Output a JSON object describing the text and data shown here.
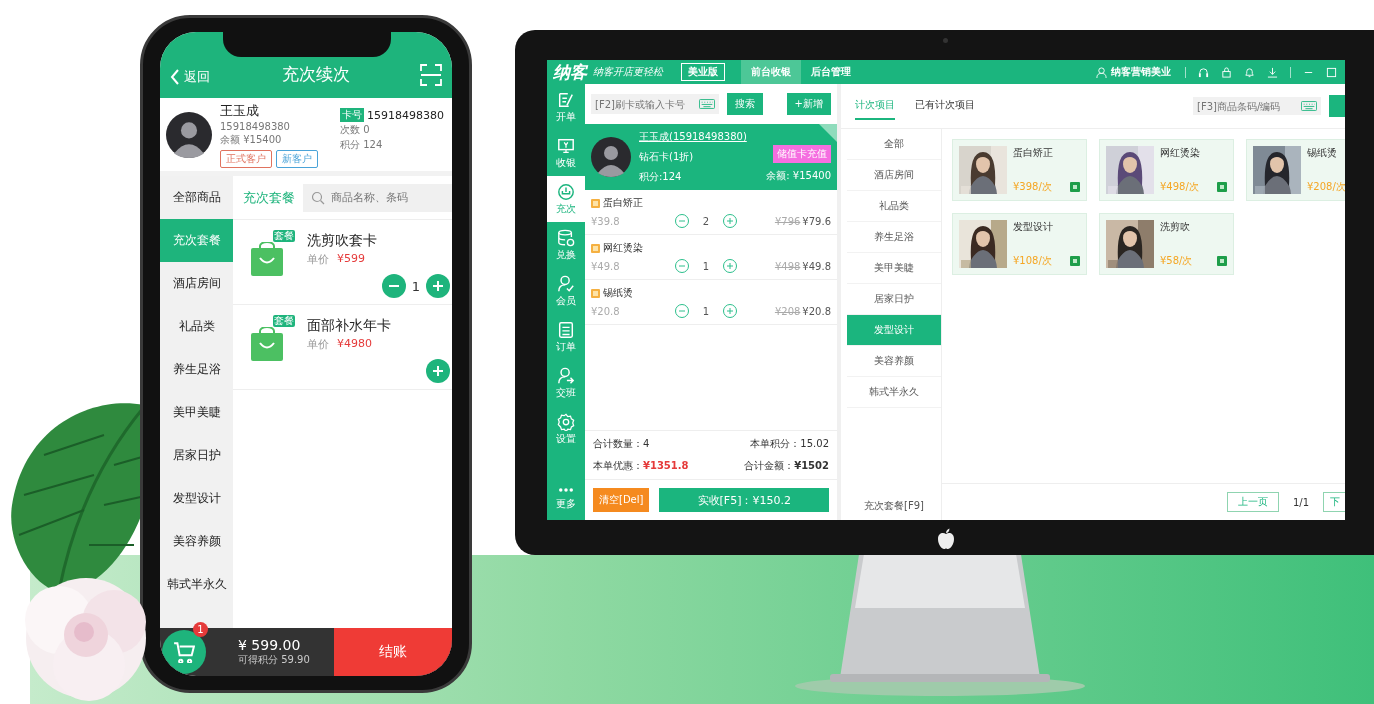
{
  "phone": {
    "header": {
      "back": "返回",
      "title": "充次续次"
    },
    "member": {
      "name": "王玉成",
      "phone": "15918498380",
      "balance": "余额 ¥15400",
      "tags": [
        {
          "label": "正式客户",
          "color": "#e0735f"
        },
        {
          "label": "新客户",
          "color": "#4aa3d8"
        }
      ],
      "card_badge": "卡号",
      "card_no": "15918498380",
      "times": "次数 0",
      "points": "积分 124"
    },
    "categories": [
      {
        "label": "全部商品",
        "selected": false
      },
      {
        "label": "充次套餐",
        "selected": true
      },
      {
        "label": "酒店房间",
        "selected": false
      },
      {
        "label": "礼品类",
        "selected": false
      },
      {
        "label": "养生足浴",
        "selected": false
      },
      {
        "label": "美甲美睫",
        "selected": false
      },
      {
        "label": "居家日护",
        "selected": false
      },
      {
        "label": "发型设计",
        "selected": false
      },
      {
        "label": "美容养颜",
        "selected": false
      },
      {
        "label": "韩式半永久",
        "selected": false
      }
    ],
    "tab": "充次套餐",
    "search": {
      "placeholder": "商品名称、条码"
    },
    "products": [
      {
        "name": "洗剪吹套卡",
        "badge": "套餐",
        "price_label": "单价",
        "price": "¥599",
        "quantity": "1"
      },
      {
        "name": "面部补水年卡",
        "badge": "套餐",
        "price_label": "单价",
        "price": "¥4980"
      }
    ],
    "cart": {
      "count": "1",
      "total": "¥ 599.00",
      "points": "可得积分 59.90",
      "checkout": "结账"
    }
  },
  "desktop": {
    "brand": "纳客",
    "slogan": "纳客开店更轻松",
    "edition": "美业版",
    "modules": [
      {
        "label": "前台收银",
        "selected": true
      },
      {
        "label": "后台管理",
        "selected": false
      }
    ],
    "user": "纳客营销美业",
    "nav": [
      {
        "label": "开单",
        "selected": false
      },
      {
        "label": "收银",
        "selected": false
      },
      {
        "label": "充次",
        "selected": true
      },
      {
        "label": "兑换",
        "selected": false
      },
      {
        "label": "会员",
        "selected": false
      },
      {
        "label": "订单",
        "selected": false
      },
      {
        "label": "交班",
        "selected": false
      },
      {
        "label": "设置",
        "selected": false
      },
      {
        "label": "更多",
        "selected": false
      }
    ],
    "card_search": {
      "placeholder": "[F2]刷卡或输入卡号"
    },
    "search_button": "搜索",
    "add_button": "+新增",
    "member": {
      "name": "王玉成(15918498380)",
      "card_type": "钻石卡(1折)",
      "points": "积分:124",
      "recharge": "储值卡充值",
      "balance": "余额: ¥15400"
    },
    "order_items": [
      {
        "name": "蛋白矫正",
        "unit_price": "¥39.8",
        "quantity": "2",
        "original": "¥796",
        "amount": "¥79.6"
      },
      {
        "name": "网红烫染",
        "unit_price": "¥49.8",
        "quantity": "1",
        "original": "¥498",
        "amount": "¥49.8"
      },
      {
        "name": "锡纸烫",
        "unit_price": "¥20.8",
        "quantity": "1",
        "original": "¥208",
        "amount": "¥20.8"
      }
    ],
    "summary": {
      "count_label": "合计数量：",
      "count": "4",
      "points_label": "本单积分：",
      "points": "15.02",
      "discount_label": "本单优惠：",
      "discount": "¥1351.8",
      "total_label": "合计金额：",
      "total": "¥1502"
    },
    "clear_button": "清空[Del]",
    "pay_button": "实收[F5]：¥150.2",
    "tabs": [
      {
        "label": "计次项目",
        "selected": true
      },
      {
        "label": "已有计次项目",
        "selected": false
      }
    ],
    "item_search": {
      "placeholder": "[F3]商品条码/编码"
    },
    "categories": [
      {
        "label": "全部",
        "selected": false
      },
      {
        "label": "酒店房间",
        "selected": false
      },
      {
        "label": "礼品类",
        "selected": false
      },
      {
        "label": "养生足浴",
        "selected": false
      },
      {
        "label": "美甲美睫",
        "selected": false
      },
      {
        "label": "居家日护",
        "selected": false
      },
      {
        "label": "发型设计",
        "selected": true
      },
      {
        "label": "美容养颜",
        "selected": false
      },
      {
        "label": "韩式半永久",
        "selected": false
      }
    ],
    "package_link": "充次套餐[F9]",
    "services": [
      {
        "name": "蛋白矫正",
        "price": "¥398/次",
        "tag_icon": true
      },
      {
        "name": "网红烫染",
        "price": "¥498/次",
        "tag_icon": true
      },
      {
        "name": "锡纸烫",
        "price": "¥208/次",
        "tag_icon": false
      },
      {
        "name": "发型设计",
        "price": "¥108/次",
        "tag_icon": true
      },
      {
        "name": "洗剪吹",
        "price": "¥58/次",
        "tag_icon": true
      }
    ],
    "pagination": {
      "prev": "上一页",
      "page": "1/1",
      "next": "下"
    }
  }
}
